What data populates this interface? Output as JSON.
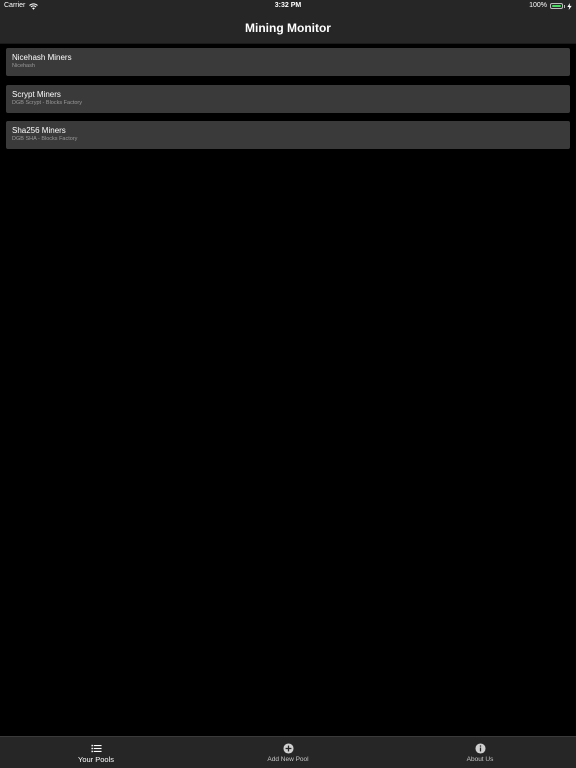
{
  "status_bar": {
    "carrier": "Carrier",
    "time": "3:32 PM",
    "battery_percent": "100%",
    "battery_level": 1.0,
    "battery_color": "#4cd964",
    "icons": [
      "wifi-icon",
      "battery-icon",
      "charging-bolt-icon"
    ]
  },
  "nav": {
    "title": "Mining Monitor"
  },
  "pools": [
    {
      "name": "Nicehash Miners",
      "subtitle": "Nicehash"
    },
    {
      "name": "Scrypt Miners",
      "subtitle": "DGB Scrypt - Blocks Factory"
    },
    {
      "name": "Sha256 Miners",
      "subtitle": "DGB SHA - Blocks Factory"
    }
  ],
  "tab_bar": {
    "selected": "Your Pools",
    "tabs": [
      {
        "label": "Your Pools",
        "icon": "list-icon"
      },
      {
        "label": "Add New Pool",
        "icon": "plus-circle-icon"
      },
      {
        "label": "About Us",
        "icon": "info-circle-icon"
      }
    ]
  },
  "colors": {
    "background": "#000000",
    "bars": "#262626",
    "row": "#3a3a3a",
    "subtitle_text": "#9a9a9a"
  }
}
